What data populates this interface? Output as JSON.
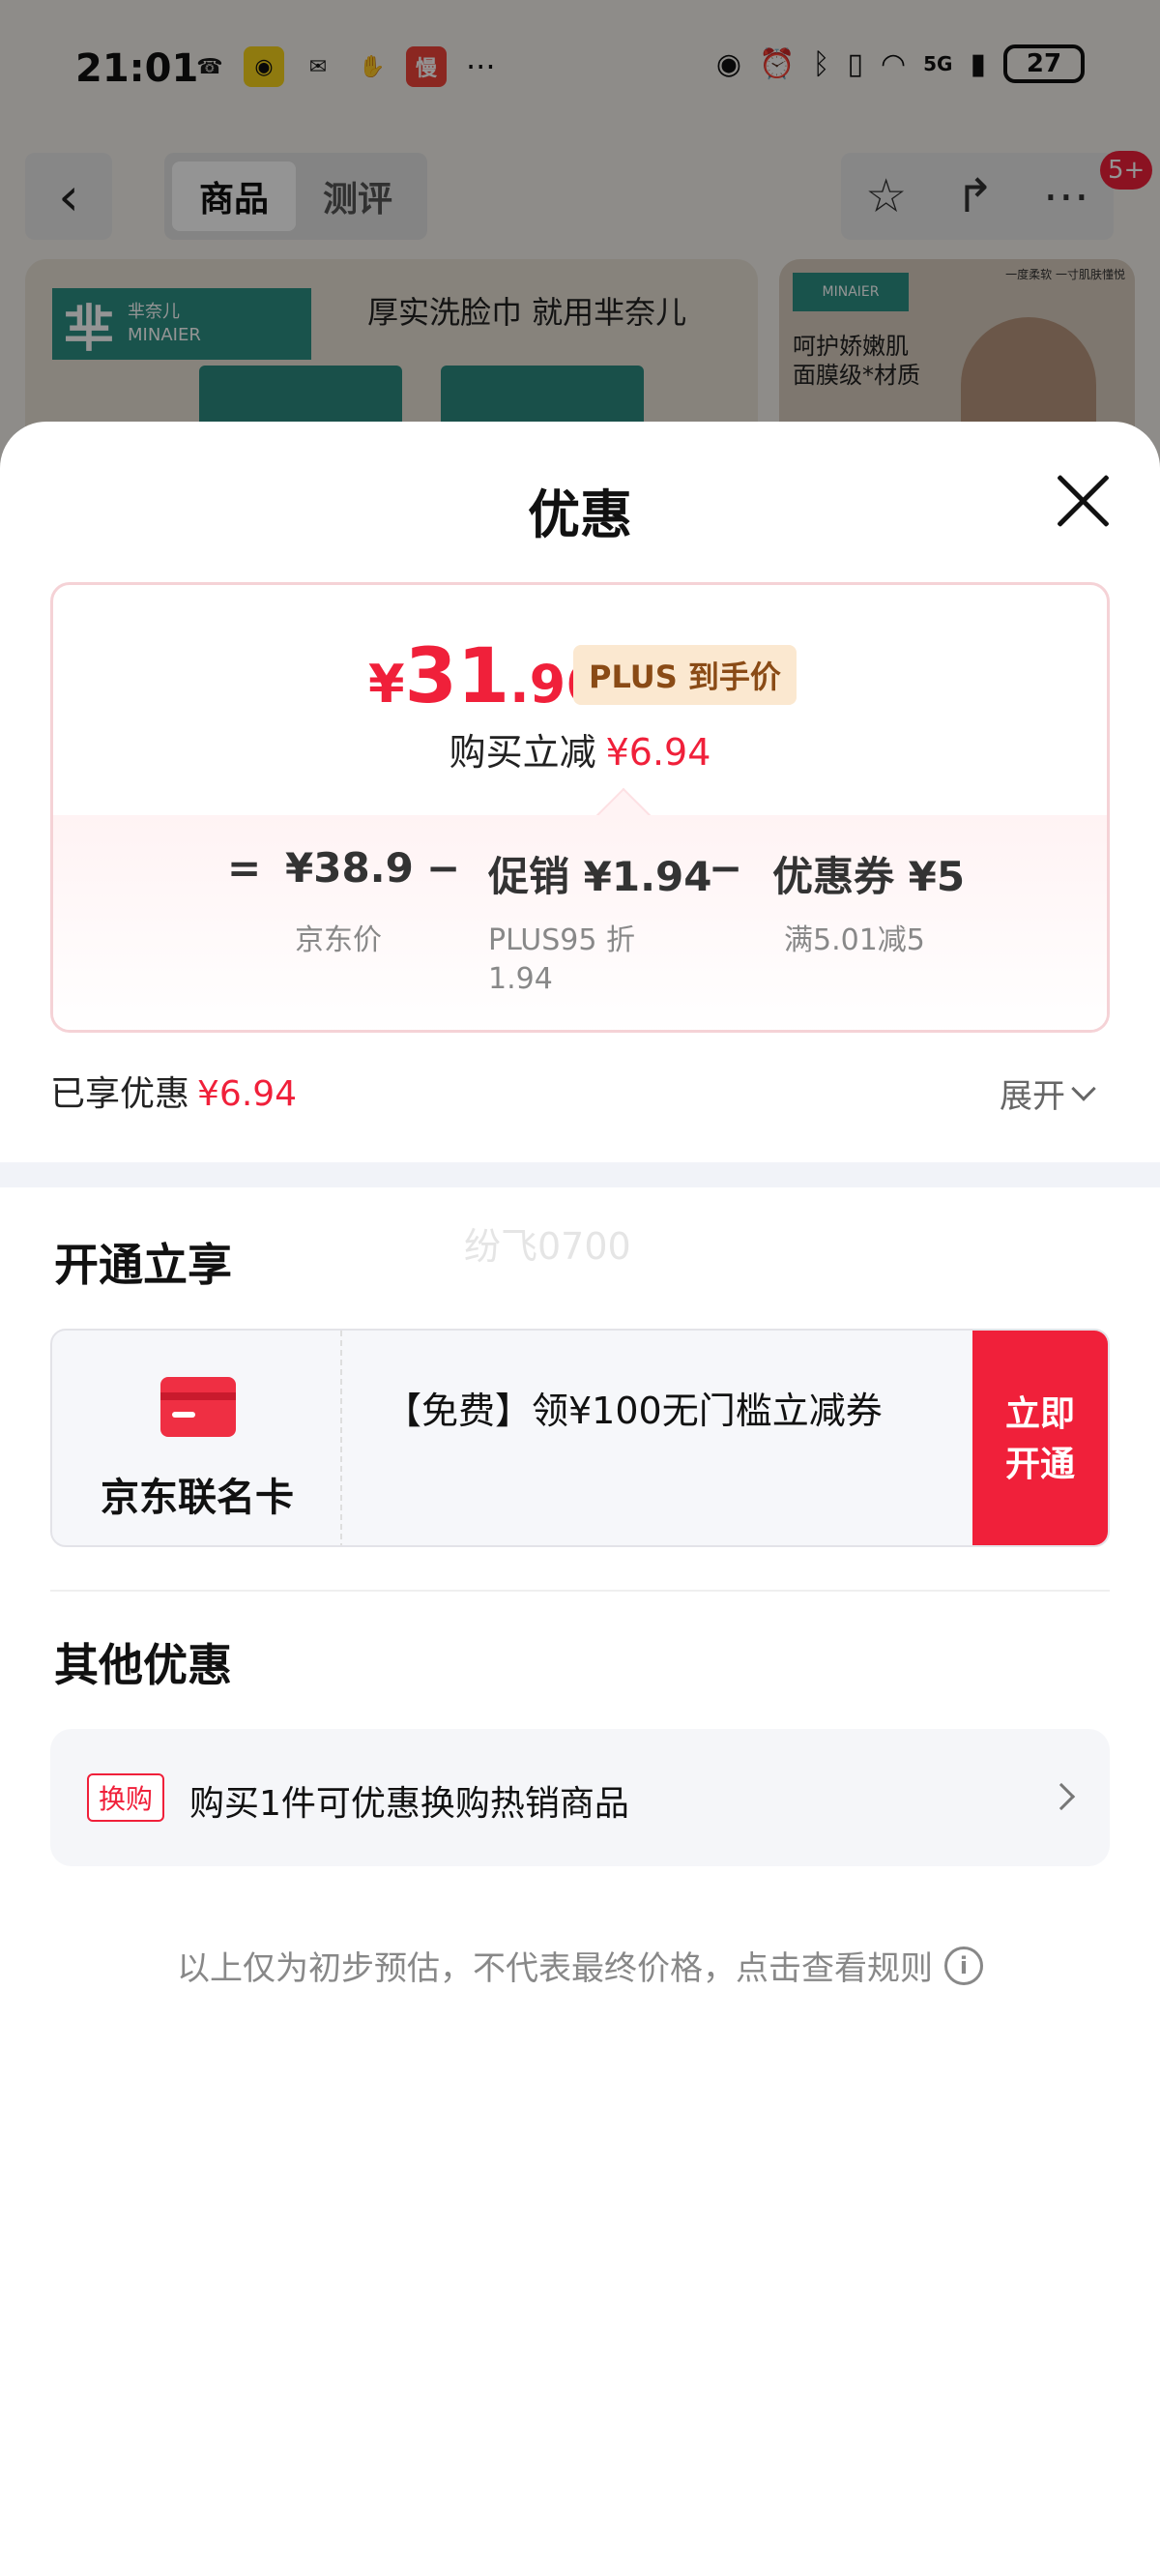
{
  "status_bar": {
    "time": "21:01",
    "app_icons": [
      "missed-call-icon",
      "app-yellow-icon",
      "wechat-icon",
      "hand-icon",
      "manga-app-icon"
    ],
    "manga_app_label": "慢",
    "more": "···",
    "network": "5G",
    "battery": "27"
  },
  "top_nav": {
    "tabs": [
      {
        "label": "商品",
        "active": true
      },
      {
        "label": "测评",
        "active": false
      }
    ],
    "badge": "5+"
  },
  "banner": {
    "brand_char": "芈",
    "brand_cn": "芈奈儿",
    "brand_en": "MINAIER",
    "slogan": "厚实洗脸巾 就用芈奈儿",
    "right_line1": "呵护娇嫩肌",
    "right_line2": "面膜级*材质",
    "right_corner": "一度柔软 一寸肌肤懂悦"
  },
  "sheet": {
    "title": "优惠",
    "price": {
      "symbol": "¥",
      "integer": "31",
      "decimal": ".96",
      "plus_tag": "PLUS 到手价",
      "reduce_label": "购买立减",
      "reduce_amount": "¥6.94"
    },
    "calc": {
      "eq": "=",
      "jd_price": "¥38.9",
      "jd_price_label": "京东价",
      "minus1": "−",
      "promo": "促销 ¥1.94",
      "promo_label_1": "PLUS95 折",
      "promo_label_2": "1.94",
      "minus2": "−",
      "coupon": "优惠券 ¥5",
      "coupon_label": "满5.01减5"
    },
    "enjoyed_label": "已享优惠",
    "enjoyed_amount": "¥6.94",
    "expand_label": "展开",
    "watermark": "纷飞0700",
    "open_section": {
      "title": "开通立享",
      "card_name": "京东联名卡",
      "desc": "【免费】领¥100无门槛立减券",
      "button_line1": "立即",
      "button_line2": "开通"
    },
    "other_section": {
      "title": "其他优惠",
      "tag": "换购",
      "text": "购买1件可优惠换购热销商品"
    },
    "footer_note": "以上仅为初步预估，不代表最终价格，点击查看规则",
    "info_glyph": "i"
  },
  "colors": {
    "accent_red": "#f0203a",
    "plus_gold_bg": "#fbe8d0",
    "plus_gold_text": "#8a4b16",
    "brand_teal": "#2b8f84"
  }
}
